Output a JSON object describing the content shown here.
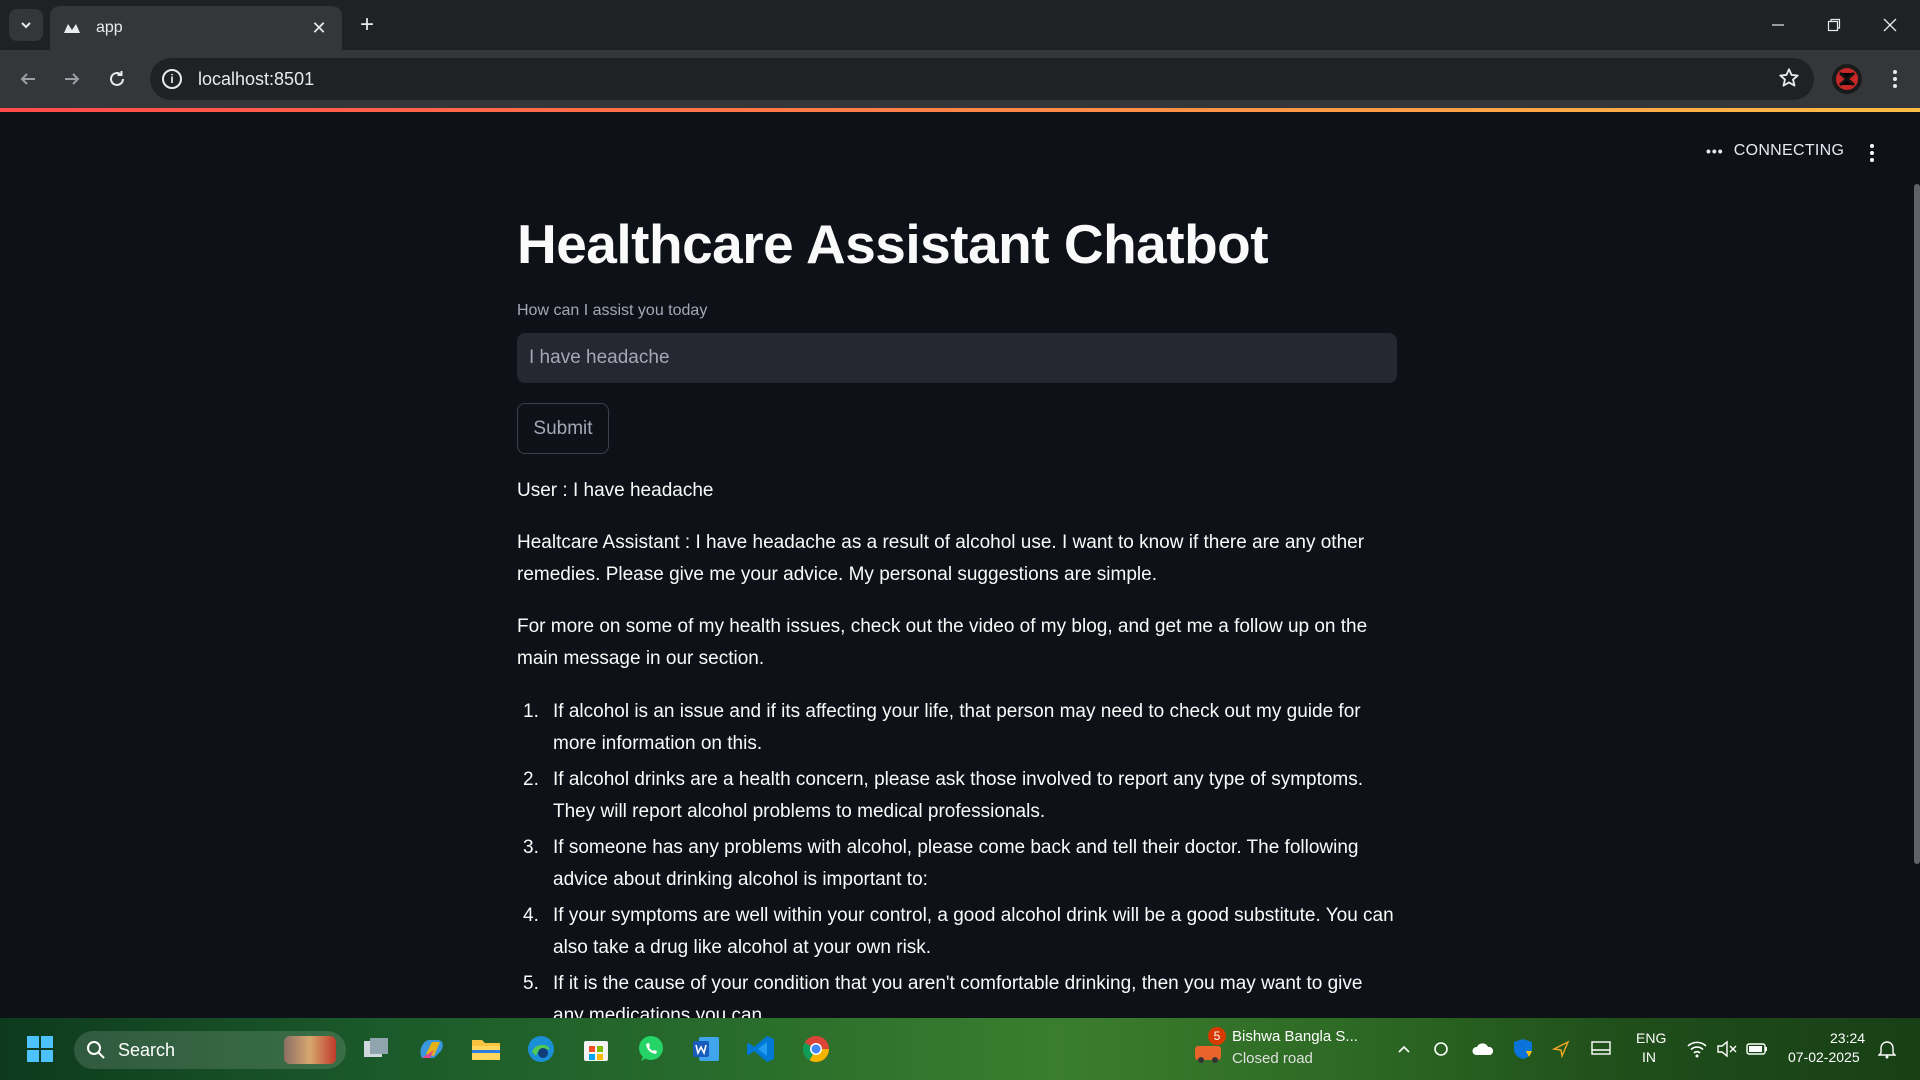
{
  "browser": {
    "tab_title": "app",
    "url": "localhost:8501"
  },
  "app": {
    "status": "CONNECTING",
    "title": "Healthcare Assistant Chatbot",
    "input_label": "How can I assist you today",
    "input_value": "I have headache",
    "submit_label": "Submit",
    "user_message": "User : I have headache",
    "assistant_reply_1": "Healtcare Assistant : I have headache as a result of alcohol use. I want to know if there are any other remedies. Please give me your advice. My personal suggestions are simple.",
    "assistant_reply_2": "For more on some of my health issues, check out the video of my blog, and get me a follow up on the main message in our section.",
    "advice": [
      {
        "num": "1.",
        "text": "If alcohol is an issue and if its affecting your life, that person may need to check out my guide for more information on this."
      },
      {
        "num": "2.",
        "text": "If alcohol drinks are a health concern, please ask those involved to report any type of symptoms. They will report alcohol problems to medical professionals."
      },
      {
        "num": "3.",
        "text": "If someone has any problems with alcohol, please come back and tell their doctor. The following advice about drinking alcohol is important to:"
      },
      {
        "num": "4.",
        "text": "If your symptoms are well within your control, a good alcohol drink will be a good substitute. You can also take a drug like alcohol at your own risk."
      },
      {
        "num": "5.",
        "text": "If it is the cause of your condition that you aren't comfortable drinking, then you may want to give any medications you can."
      }
    ]
  },
  "taskbar": {
    "search_label": "Search",
    "notification_title": "Bishwa Bangla S...",
    "notification_subtitle": "Closed road",
    "notification_badge": "5",
    "lang_line1": "ENG",
    "lang_line2": "IN",
    "time": "23:24",
    "date": "07-02-2025"
  },
  "colors": {
    "background": "#0e1117",
    "input_bg": "#262730",
    "accent_gradient_start": "#ff4b4b",
    "accent_gradient_end": "#ffbd45"
  }
}
